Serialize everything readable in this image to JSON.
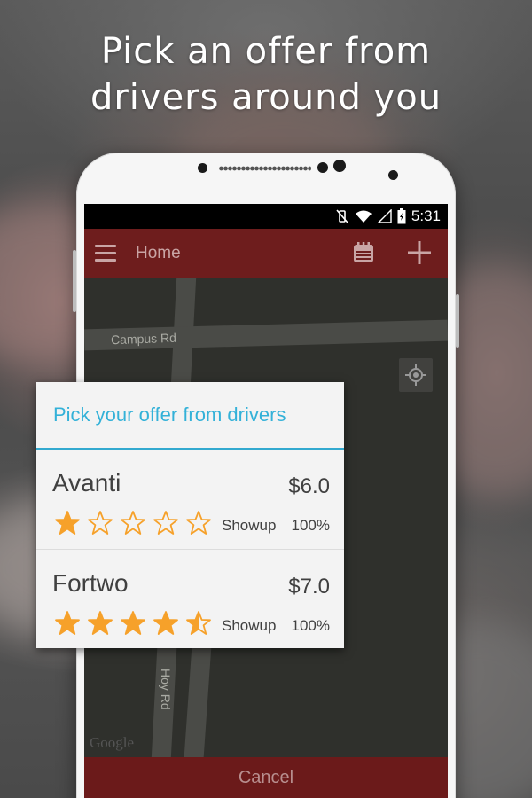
{
  "headline": {
    "line1": "Pick an offer from",
    "line2": "drivers around you"
  },
  "status_bar": {
    "time": "5:31"
  },
  "app_bar": {
    "title": "Home",
    "icons": [
      "menu-icon",
      "calendar-icon",
      "plus-icon"
    ]
  },
  "map": {
    "roads": [
      "Campus Rd",
      "Hoy Rd"
    ],
    "attribution": "Google"
  },
  "dialog": {
    "title": "Pick your offer from drivers",
    "offers": [
      {
        "driver": "Avanti",
        "price": "$6.0",
        "rating": 1,
        "rating_max": 5,
        "showup_label": "Showup",
        "showup_value": "100%"
      },
      {
        "driver": "Fortwo",
        "price": "$7.0",
        "rating": 4.5,
        "rating_max": 5,
        "showup_label": "Showup",
        "showup_value": "100%"
      }
    ]
  },
  "cancel_label": "Cancel",
  "colors": {
    "accent_blue": "#33b1d8",
    "app_bar_red": "#6e1d1d",
    "star_orange": "#f6a12a"
  }
}
